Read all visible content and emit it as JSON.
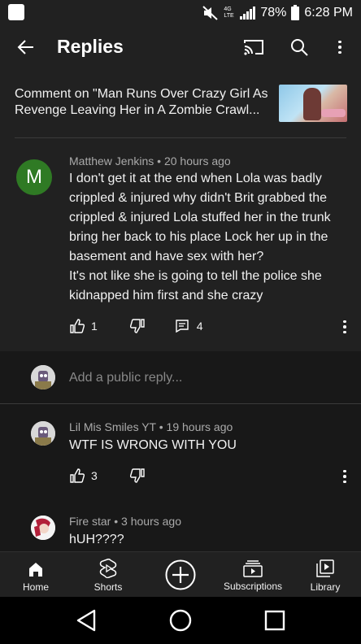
{
  "status_bar": {
    "network": "4G LTE",
    "battery": "78%",
    "time": "6:28 PM"
  },
  "app_bar": {
    "title": "Replies",
    "icons": [
      "back-arrow-icon",
      "cast-icon",
      "search-icon",
      "more-vert-icon"
    ]
  },
  "context": {
    "text": "Comment on \"Man Runs Over Crazy Girl As Revenge Leaving Her in A Zombie Crawl..."
  },
  "main_comment": {
    "avatar_letter": "M",
    "avatar_color": "#2f7a24",
    "author": "Matthew Jenkins",
    "time": "20 hours ago",
    "lines": [
      "I don't get it at the end when Lola was badly",
      "crippled & injured why didn't Brit grabbed the",
      "crippled & injured Lola stuffed her in the trunk",
      "bring her back to his place Lock her up in the",
      "basement and have sex with her?",
      "It's not like she is going to tell the police she",
      "kidnapped him first and she crazy"
    ],
    "likes": "1",
    "replies": "4"
  },
  "reply_input": {
    "placeholder": "Add a public reply..."
  },
  "replies": [
    {
      "author": "Lil Mis Smiles YT",
      "time": "19 hours ago",
      "text": "WTF IS WRONG WITH YOU",
      "likes": "3"
    },
    {
      "author": "Fire star",
      "time": "3 hours ago",
      "text": "hUH????"
    }
  ],
  "bottom_nav": [
    {
      "label": "Home",
      "icon": "home-icon"
    },
    {
      "label": "Shorts",
      "icon": "shorts-icon"
    },
    {
      "label": "",
      "icon": "create-plus-icon"
    },
    {
      "label": "Subscriptions",
      "icon": "subscriptions-icon"
    },
    {
      "label": "Library",
      "icon": "library-icon"
    }
  ]
}
